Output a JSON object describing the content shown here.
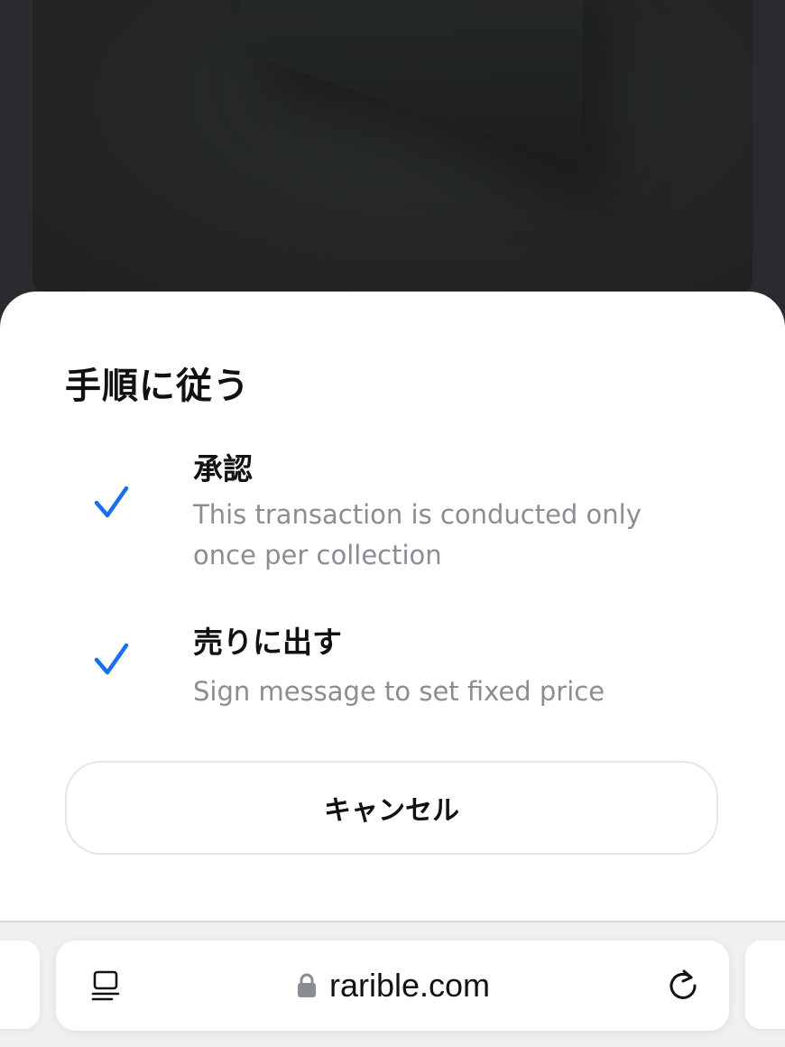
{
  "sheet": {
    "title": "手順に従う",
    "steps": [
      {
        "title": "承認",
        "description": "This transaction is conducted only once per collection",
        "status": "completed",
        "icon": "checkmark-icon"
      },
      {
        "title": "売りに出す",
        "description": "Sign message to set fixed price",
        "status": "completed",
        "icon": "checkmark-icon"
      }
    ],
    "cancel_label": "キャンセル"
  },
  "browser": {
    "url": "rarible.com",
    "icons": {
      "reader": "reader-mode-icon",
      "lock": "lock-icon",
      "reload": "reload-icon"
    }
  },
  "colors": {
    "accent": "#1f6feb",
    "check": "#1a6ff0",
    "muted_text": "#8a8d93",
    "backdrop": "#2a2b2e"
  }
}
